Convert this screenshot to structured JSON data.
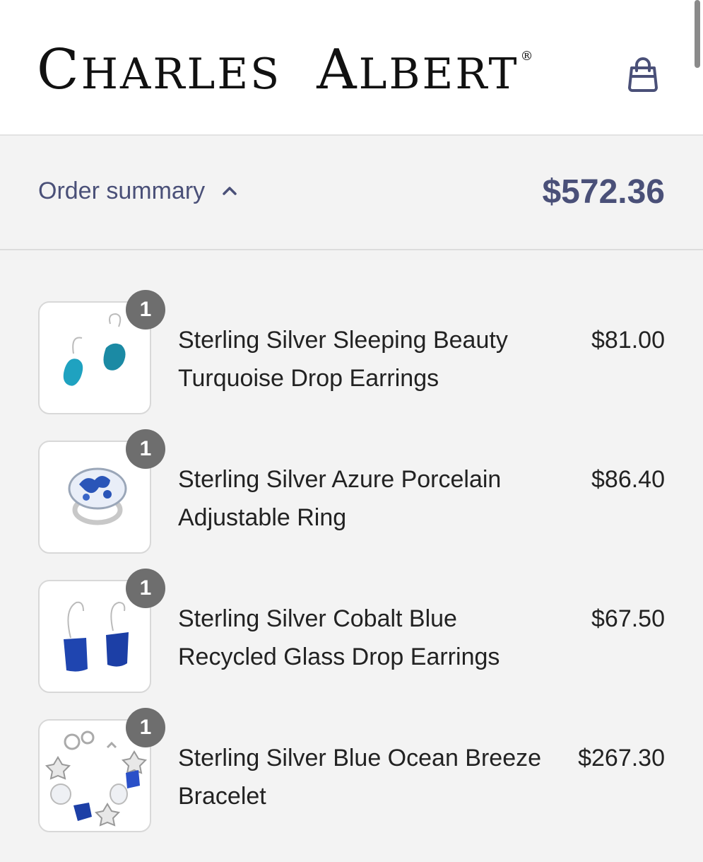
{
  "header": {
    "brand_part1_initial": "C",
    "brand_part1_rest": "HARLES",
    "brand_part2_initial": "A",
    "brand_part2_rest": "LBERT",
    "brand_mark": "®",
    "cart_icon": "shopping-bag-icon"
  },
  "summary": {
    "label": "Order summary",
    "toggle_icon": "chevron-up-icon",
    "total": "$572.36"
  },
  "items": [
    {
      "qty": "1",
      "name": "Sterling Silver Sleeping Beauty Turquoise Drop Earrings",
      "price": "$81.00",
      "image": "turquoise-earrings-image"
    },
    {
      "qty": "1",
      "name": "Sterling Silver Azure Porcelain Adjustable Ring",
      "price": "$86.40",
      "image": "porcelain-ring-image"
    },
    {
      "qty": "1",
      "name": "Sterling Silver Cobalt Blue Recycled Glass Drop Earrings",
      "price": "$67.50",
      "image": "cobalt-earrings-image"
    },
    {
      "qty": "1",
      "name": "Sterling Silver Blue Ocean Breeze Bracelet",
      "price": "$267.30",
      "image": "ocean-bracelet-image"
    }
  ],
  "colors": {
    "accent": "#4a5078",
    "badge": "#6e6e6e",
    "background": "#f3f3f3"
  }
}
